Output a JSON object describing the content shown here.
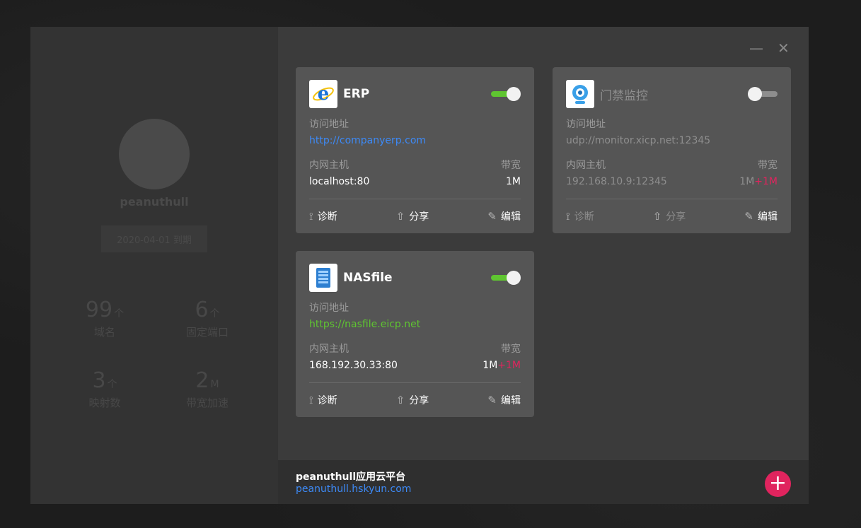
{
  "profile": {
    "username": "peanuthull",
    "expiry": "2020-04-01 到期",
    "stats": [
      {
        "value": "99",
        "unit": "个",
        "label": "域名"
      },
      {
        "value": "6",
        "unit": "个",
        "label": "固定端口"
      },
      {
        "value": "3",
        "unit": "个",
        "label": "映射数"
      },
      {
        "value": "2",
        "unit": "M",
        "label": "带宽加速"
      }
    ]
  },
  "window_controls": {
    "minimize": "—",
    "close": "✕"
  },
  "labels": {
    "access_address": "访问地址",
    "internal_host": "内网主机",
    "bandwidth": "带宽",
    "diagnose": "诊断",
    "share": "分享",
    "edit": "编辑"
  },
  "cards": [
    {
      "name": "ERP",
      "icon": "ie-icon",
      "enabled": true,
      "url": "http://companyerp.com",
      "url_color": "#3d8af7",
      "host": "localhost:80",
      "bandwidth": "1M",
      "bandwidth_extra": ""
    },
    {
      "name": "门禁监控",
      "icon": "webcam-icon",
      "enabled": false,
      "url": "udp://monitor.xicp.net:12345",
      "url_color": "#8e8e8e",
      "host": "192.168.10.9:12345",
      "bandwidth": "1M",
      "bandwidth_extra": "+1M"
    },
    {
      "name": "NASfile",
      "icon": "nas-icon",
      "enabled": true,
      "url": "https://nasfile.eicp.net",
      "url_color": "#5fc531",
      "host": "168.192.30.33:80",
      "bandwidth": "1M",
      "bandwidth_extra": "+1M"
    }
  ],
  "footer": {
    "title": "peanuthull应用云平台",
    "link": "peanuthull.hskyun.com",
    "add_label": "+"
  },
  "colors": {
    "accent_red": "#e0245e",
    "toggle_on": "#5fc531",
    "link_blue": "#3d8af7"
  }
}
